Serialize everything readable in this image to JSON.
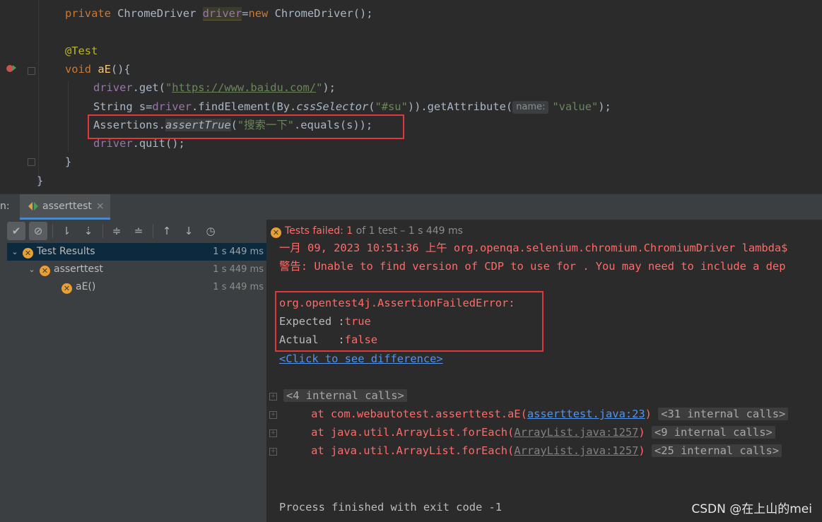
{
  "editor": {
    "line1": {
      "kw": "private",
      "type": " ChromeDriver ",
      "var": "driver",
      "eq": "=",
      "new": "new",
      "rest": " ChromeDriver();"
    },
    "line3": {
      "ann": "@Test"
    },
    "line4": {
      "kw": "void",
      "name": " aE",
      "rest": "(){"
    },
    "line5": {
      "obj": "driver",
      "call": ".get(",
      "q1": "\"",
      "url": "https://www.baidu.com/",
      "q2": "\"",
      "end": ");"
    },
    "line6": {
      "decl": "String s=",
      "obj": "driver",
      "call": ".findElement(By.",
      "method": "cssSelector",
      "open": "(",
      "sel": "\"#su\"",
      "mid": ")).getAttribute(",
      "hint": "name:",
      "val": "\"value\"",
      "end": ");"
    },
    "line7": {
      "cls": "Assertions.",
      "method": "assertTrue",
      "open": "(",
      "str": "\"搜索一下\"",
      "rest": ".equals(s));"
    },
    "line8": {
      "obj": "driver",
      "rest": ".quit();"
    },
    "line9": {
      "brace": "}"
    },
    "line10": {
      "brace": "}"
    }
  },
  "run": {
    "label": "n:",
    "tab_name": "asserttest",
    "status_failed": "Tests failed: ",
    "status_count": "1",
    "status_rest": " of 1 test – 1 s 449 ms"
  },
  "tree": [
    {
      "label": "Test Results",
      "time": "1 s 449 ms"
    },
    {
      "label": "asserttest",
      "time": "1 s 449 ms"
    },
    {
      "label": "aE()",
      "time": "1 s 449 ms"
    }
  ],
  "console": {
    "log1": "一月 09, 2023 10:51:36 上午 org.openqa.selenium.chromium.ChromiumDriver lambda$",
    "log2": "警告: Unable to find version of CDP to use for . You may need to include a dep",
    "err_class": "org.opentest4j.AssertionFailedError:",
    "expected_label": "Expected :",
    "expected_val": "true",
    "actual_label": "Actual   :",
    "actual_val": "false",
    "diff_link": "<Click to see difference>",
    "internal1": "<4 internal calls>",
    "st1_pre": "    at com.webautotest.asserttest.aE(",
    "st1_link": "asserttest.java:23",
    "st1_post": ")",
    "st1_int": "<31 internal calls>",
    "st2_pre": "    at java.util.ArrayList.forEach(",
    "st2_link": "ArrayList.java:1257",
    "st2_post": ")",
    "st2_int": "<9 internal calls>",
    "st3_pre": "    at java.util.ArrayList.forEach(",
    "st3_link": "ArrayList.java:1257",
    "st3_post": ")",
    "st3_int": "<25 internal calls>",
    "process": "Process finished with exit code -1"
  },
  "watermark": "CSDN @在上山的mei",
  "colors": {
    "error": "#ff6b68",
    "highlight_box": "#e0383a",
    "keyword": "#cc7832"
  }
}
